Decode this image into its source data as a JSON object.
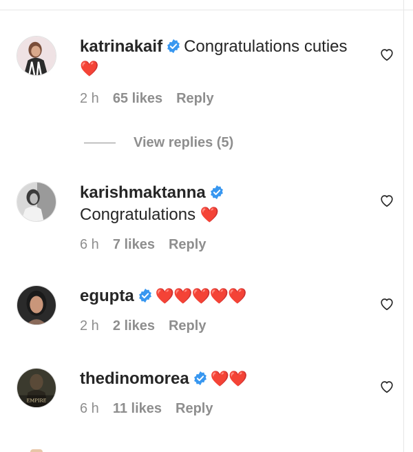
{
  "colors": {
    "verified_blue": "#3897f0",
    "meta_gray": "#8e8e8e",
    "heart_red": "#ed1c24"
  },
  "comments": [
    {
      "username": "katrinakaif",
      "verified": true,
      "text": "Congratulations cuties",
      "emoji": "❤️",
      "time": "2 h",
      "likes": "65 likes",
      "reply": "Reply",
      "view_replies": "View replies (5)"
    },
    {
      "username": "karishmaktanna",
      "verified": true,
      "text": "Congratulations",
      "emoji": "❤️",
      "time": "6 h",
      "likes": "7 likes",
      "reply": "Reply"
    },
    {
      "username": "egupta",
      "verified": true,
      "text": "",
      "emoji": "❤️❤️❤️❤️❤️",
      "time": "2 h",
      "likes": "2 likes",
      "reply": "Reply"
    },
    {
      "username": "thedinomorea",
      "verified": true,
      "text": "",
      "emoji": "❤️❤️",
      "time": "6 h",
      "likes": "11 likes",
      "reply": "Reply",
      "avatar_caption": "EMPIRE"
    }
  ],
  "icons": {
    "verified": "verified-badge-icon",
    "like": "heart-outline-icon"
  }
}
